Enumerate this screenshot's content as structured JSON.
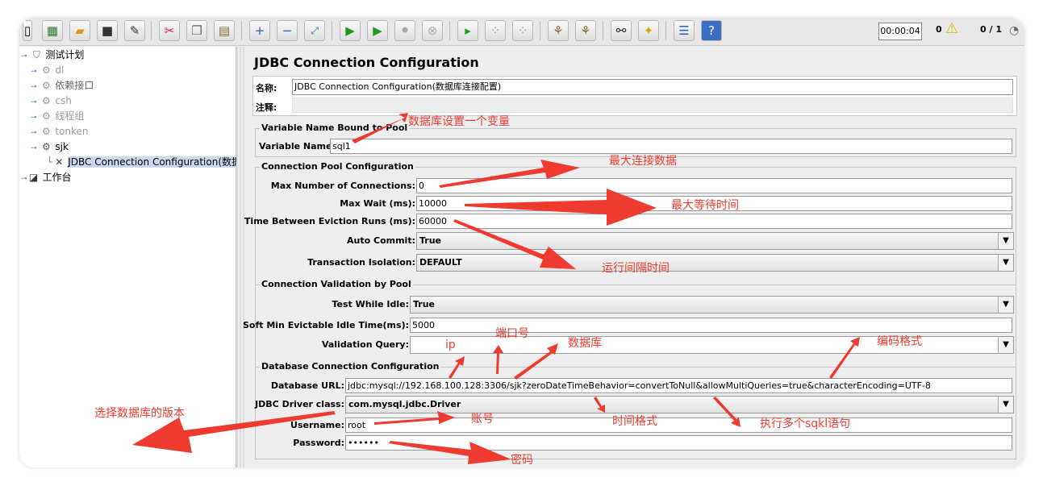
{
  "toolbar": {
    "buttons": [
      "new-icon",
      "templates-icon",
      "open-icon",
      "save-icon",
      "save-as-icon",
      "cut-icon",
      "copy-icon",
      "paste-icon",
      "expand-icon",
      "collapse-icon",
      "toggle-icon",
      "start-icon",
      "start-no-pause-icon",
      "stop-icon",
      "shutdown-icon",
      "remote-start-icon",
      "remote-stop-icon",
      "remote-exit-icon",
      "clear-icon",
      "clear-all-icon",
      "search-icon",
      "reset-search-icon",
      "function-helper-icon",
      "help-icon"
    ],
    "timer": "00:00:04",
    "warnings": "0",
    "threads": "0 / 1"
  },
  "tree": {
    "items": [
      {
        "label": "测试计划",
        "icon": "test-plan-icon",
        "state": "enabled"
      },
      {
        "label": "dl",
        "icon": "thread-group-icon",
        "state": "disabled"
      },
      {
        "label": "依赖接口",
        "icon": "thread-group-icon",
        "state": "enabled"
      },
      {
        "label": "csh",
        "icon": "thread-group-icon",
        "state": "disabled"
      },
      {
        "label": "线程组",
        "icon": "thread-group-icon",
        "state": "disabled"
      },
      {
        "label": "tonken",
        "icon": "thread-group-icon",
        "state": "disabled"
      },
      {
        "label": "sjk",
        "icon": "thread-group-icon",
        "state": "enabled"
      },
      {
        "label": "JDBC Connection Configuration(数据",
        "icon": "jdbc-config-icon",
        "state": "selected"
      },
      {
        "label": "工作台",
        "icon": "workbench-icon",
        "state": "enabled"
      }
    ]
  },
  "panel": {
    "title": "JDBC Connection Configuration",
    "name_label": "名称:",
    "name_value": "JDBC Connection Configuration(数据库连接配置)",
    "comment_label": "注释:",
    "comment_value": ""
  },
  "variable": {
    "legend": "Variable Name Bound to Pool",
    "name_label": "Variable Name:",
    "name_value": "sql1"
  },
  "pool": {
    "legend": "Connection Pool Configuration",
    "max_conn_label": "Max Number of Connections:",
    "max_conn_value": "0",
    "max_wait_label": "Max Wait (ms):",
    "max_wait_value": "10000",
    "eviction_label": "Time Between Eviction Runs (ms):",
    "eviction_value": "60000",
    "autocommit_label": "Auto Commit:",
    "autocommit_value": "True",
    "isolation_label": "Transaction Isolation:",
    "isolation_value": "DEFAULT"
  },
  "validation": {
    "legend": "Connection Validation by Pool",
    "test_idle_label": "Test While Idle:",
    "test_idle_value": "True",
    "soft_min_label": "Soft Min Evictable Idle Time(ms):",
    "soft_min_value": "5000",
    "query_label": "Validation Query:",
    "query_value": ""
  },
  "database": {
    "legend": "Database Connection Configuration",
    "url_label": "Database URL:",
    "url_value": "jdbc:mysql://192.168.100.128:3306/sjk?zeroDateTimeBehavior=convertToNull&allowMultiQueries=true&characterEncoding=UTF-8",
    "driver_label": "JDBC Driver class:",
    "driver_value": "com.mysql.jdbc.Driver",
    "username_label": "Username:",
    "username_value": "root",
    "password_label": "Password:",
    "password_value": "••••••"
  },
  "annotations": {
    "db_variable": "数据库设置一个变量",
    "max_conn": "最大连接数据",
    "max_wait": "最大等待时间",
    "eviction": "运行间隔时间",
    "port": "端口号",
    "database": "数据库",
    "ip": "ip",
    "encoding": "编码格式",
    "driver_version": "选择数据库的版本",
    "account": "账号",
    "time_format": "时间格式",
    "multi_sql": "执行多个sqkl语句",
    "password": "密码"
  },
  "colors": {
    "annotation": "#ef3a2f",
    "selection": "#c7d8ef",
    "panel_bg": "#eeeeee"
  }
}
